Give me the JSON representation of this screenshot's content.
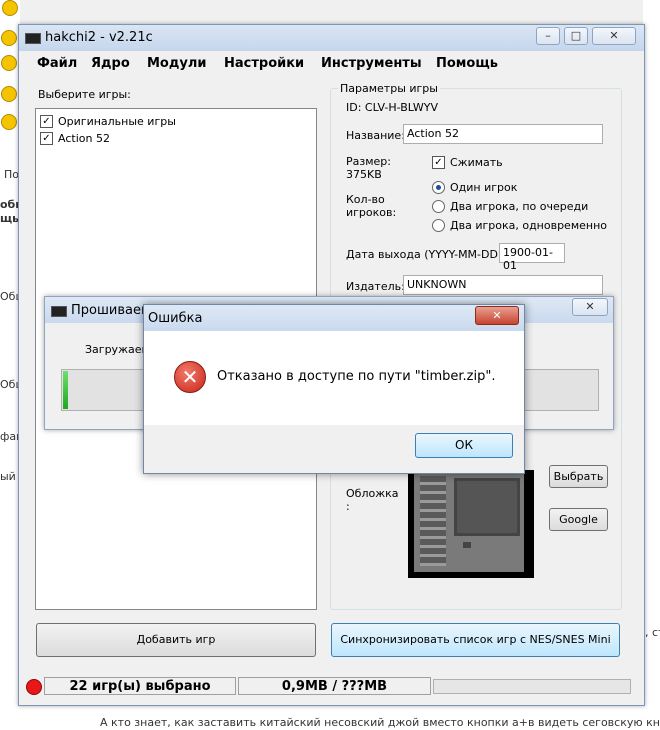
{
  "background": {
    "left_fragments": [
      "По",
      "обы",
      "щь п",
      "Общ",
      "Общ",
      "фай",
      "ый"
    ],
    "right_fragment": ", ст",
    "bottom_text": "А кто знает, как заставить китайский несовский джой вместо кнопки а+в видеть сеговскую кнопк"
  },
  "window": {
    "title": "hakchi2 - v2.21c",
    "menu": [
      "Файл",
      "Ядро",
      "Модули",
      "Настройки",
      "Инструменты",
      "Помощь"
    ]
  },
  "games_panel": {
    "label": "Выберите игры:",
    "items": [
      {
        "label": "Оригинальные игры",
        "checked": true
      },
      {
        "label": "Action 52",
        "checked": true
      }
    ],
    "add_button": "Добавить игр"
  },
  "params": {
    "label": "Параметры игры",
    "id_text": "ID: CLV-H-BLWYV",
    "name_label": "Название:",
    "name_value": "Action 52",
    "size_label": "Размер:",
    "size_value": "375KB",
    "compress_label": "Сжимать",
    "players_label": "Кол-во игроков:",
    "player_options": [
      "Один игрок",
      "Два игрока, по очереди",
      "Два игрока, одновременно"
    ],
    "date_label": "Дата выхода (YYYY-MM-DD):",
    "date_value": "1900-01-01",
    "publisher_label": "Издатель:",
    "publisher_value": "UNKNOWN",
    "cover_label": "Обложка :",
    "browse_button": "Выбрать",
    "google_button": "Google"
  },
  "sync_button": "Синхронизировать список игр с NES/SNES Mini",
  "status": {
    "selected": "22 игр(ы) выбрано",
    "size": "0,9MB / ???MB"
  },
  "progress_dialog": {
    "title": "Прошиваем",
    "message": "Загружаем",
    "progress": 0.01
  },
  "error_dialog": {
    "title": "Ошибка",
    "message": "Отказано в доступе по пути \"timber.zip\".",
    "ok": "ОК"
  }
}
